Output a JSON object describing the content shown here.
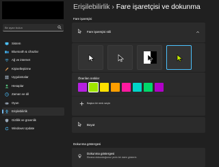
{
  "sidebar": {
    "search_placeholder": "Bir ayarı bulun",
    "items": [
      {
        "label": "Sistem",
        "icon": "monitor-icon",
        "color": "#4cc2ff"
      },
      {
        "label": "Bluetooth & cihazlar",
        "icon": "bluetooth-icon",
        "color": "#4cc2ff"
      },
      {
        "label": "Ağ ve internet",
        "icon": "wifi-icon",
        "color": "#4cc2ff"
      },
      {
        "label": "Kişiselleştirme",
        "icon": "brush-icon",
        "color": "#e8a35c"
      },
      {
        "label": "Uygulamalar",
        "icon": "apps-icon",
        "color": "#9aa8b8"
      },
      {
        "label": "Hesaplar",
        "icon": "person-icon",
        "color": "#54c27c"
      },
      {
        "label": "Zaman ve dil",
        "icon": "clock-globe-icon",
        "color": "#4cc2ff"
      },
      {
        "label": "Oyun",
        "icon": "gamepad-icon",
        "color": "#9aa8b8"
      },
      {
        "label": "Erişilebilirlik",
        "icon": "accessibility-icon",
        "color": "#4cc2ff"
      },
      {
        "label": "Gizlilik ve güvenlik",
        "icon": "shield-icon",
        "color": "#9aa8b8"
      },
      {
        "label": "Windows Update",
        "icon": "update-icon",
        "color": "#4cc2ff"
      }
    ],
    "selected_index": 8
  },
  "header": {
    "parent": "Erişilebilirlik",
    "separator": "›",
    "title": "Fare işaretçisi ve dokunma"
  },
  "pointer_section": {
    "label": "Fare işaretçisi",
    "style_card": {
      "title": "Fare işaretçisi stili",
      "styles": [
        {
          "name": "white",
          "selected": false
        },
        {
          "name": "black",
          "selected": false
        },
        {
          "name": "inverted",
          "selected": false
        },
        {
          "name": "custom",
          "selected": true
        }
      ]
    },
    "colors": {
      "label": "Önerilen renkler",
      "swatches": [
        "#b620e0",
        "#9ee600",
        "#ffe100",
        "#ff9f00",
        "#ff1aa0",
        "#00d5c8",
        "#00d86a",
        "#b000c8"
      ],
      "selected_index": 1,
      "custom_label": "Başka bir renk seçin"
    },
    "size": {
      "label": "Boyut"
    }
  },
  "touch_section": {
    "label": "Dokunma göstergesi",
    "row": {
      "title": "Dokunma göstergesi",
      "subtitle": "Ekrana dokunduğunuz yerin bir daire gösterin"
    }
  }
}
